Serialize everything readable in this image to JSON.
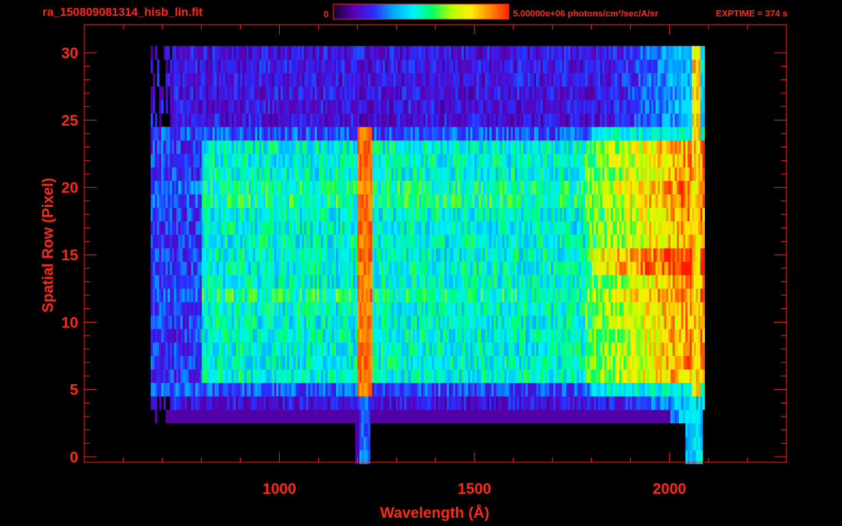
{
  "header": {
    "filename": "ra_150809081314_hisb_lin.fit",
    "colorbar_min": "0",
    "colorbar_max_label": "5.00000e+06 photons/cm²/sec/A/sr",
    "exposure": "EXPTIME = 374 s"
  },
  "colors": {
    "axis": "#ff2a1a",
    "background": "#000000",
    "colormap": [
      "#1a0033",
      "#5a00b4",
      "#2b2bff",
      "#00a8ff",
      "#00f0ff",
      "#00ff66",
      "#b8ff00",
      "#ffee00",
      "#ff8800",
      "#ff1a00"
    ]
  },
  "chart_data": {
    "type": "heatmap",
    "title": "",
    "xlabel": "Wavelength (Å)",
    "ylabel": "Spatial Row (Pixel)",
    "xlim": [
      500,
      2300
    ],
    "ylim": [
      0,
      30
    ],
    "xticks": [
      1000,
      1500,
      2000
    ],
    "yticks": [
      0,
      5,
      10,
      15,
      20,
      25,
      30
    ],
    "colorbar": {
      "min": 0,
      "max": 5000000,
      "units": "photons/cm²/sec/A/sr"
    },
    "exptime_s": 374,
    "features": {
      "bright_emission_line_angstrom": 1216,
      "data_wavelength_range": [
        670,
        2090
      ],
      "bright_spatial_rows": [
        6,
        24
      ]
    }
  }
}
